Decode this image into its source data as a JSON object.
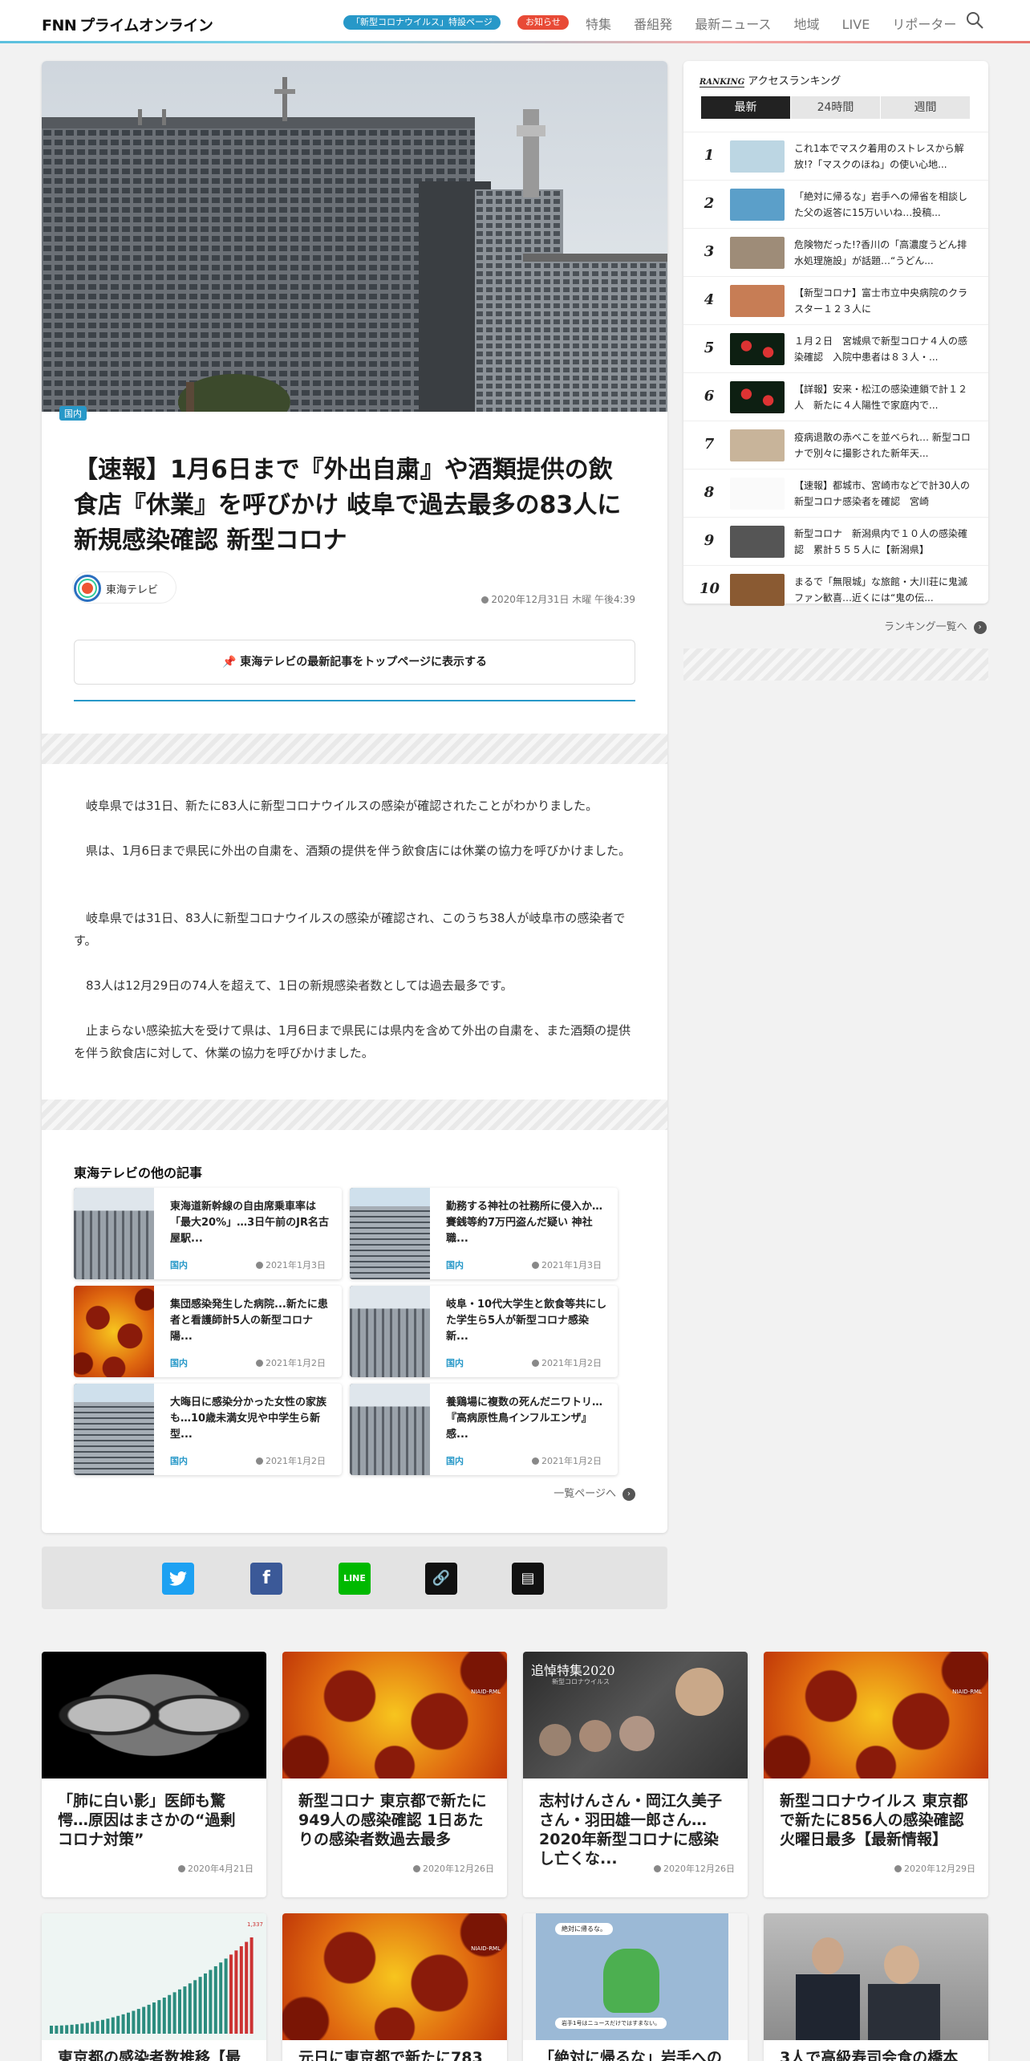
{
  "header": {
    "logo_fnn": "FNN",
    "logo_text": "プライムオンライン",
    "covid_pill": "「新型コロナウイルス」特設ページ",
    "notice_pill": "お知らせ",
    "nav": [
      "特集",
      "番組発",
      "最新ニュース",
      "地域",
      "LIVE",
      "リポーター"
    ]
  },
  "article": {
    "category": "国内",
    "title": "【速報】1月6日まで『外出自粛』や酒類提供の飲食店『休業』を呼びかけ 岐阜で過去最多の83人に新規感染確認 新型コロナ",
    "source": "東海テレビ",
    "date": "2020年12月31日 木曜 午後4:39",
    "follow_label": "東海テレビの最新記事をトップページに表示する",
    "paragraphs": [
      "岐阜県では31日、新たに83人に新型コロナウイルスの感染が確認されたことがわかりました。",
      "県は、1月6日まで県民に外出の自粛を、酒類の提供を伴う飲食店には休業の協力を呼びかけました。",
      "岐阜県では31日、83人に新型コロナウイルスの感染が確認され、このうち38人が岐阜市の感染者です。",
      "83人は12月29日の74人を超えて、1日の新規感染者数としては過去最多です。",
      "止まらない感染拡大を受けて県は、1月6日まで県民には県内を含めて外出の自粛を、また酒類の提供を伴う飲食店に対して、休業の協力を呼びかけました。"
    ]
  },
  "others": {
    "heading": "東海テレビの他の記事",
    "more": "一覧ページへ",
    "items": [
      {
        "title": "東海道新幹線の自由席乗車率は「最大20%」…3日午前のJR名古屋駅...",
        "category": "国内",
        "date": "2021年1月3日"
      },
      {
        "title": "勤務する神社の社務所に侵入か…賽銭等約7万円盗んだ疑い 神社職...",
        "category": "国内",
        "date": "2021年1月3日"
      },
      {
        "title": "集団感染発生した病院...新たに患者と看護師計5人の新型コロナ陽...",
        "category": "国内",
        "date": "2021年1月2日"
      },
      {
        "title": "岐阜・10代大学生と飲食等共にした学生ら5人が新型コロナ感染 新...",
        "category": "国内",
        "date": "2021年1月2日"
      },
      {
        "title": "大晦日に感染分かった女性の家族も…10歳未満女児や中学生ら新型...",
        "category": "国内",
        "date": "2021年1月2日"
      },
      {
        "title": "養鶏場に複数の死んだニワトリ…『高病原性鳥インフルエンザ』感...",
        "category": "国内",
        "date": "2021年1月2日"
      }
    ]
  },
  "ranking": {
    "badge": "RANKING",
    "heading": "アクセスランキング",
    "tabs": [
      "最新",
      "24時間",
      "週間"
    ],
    "more": "ランキング一覧へ",
    "items": [
      {
        "num": "1",
        "text": "これ1本でマスク着用のストレスから解放!?「マスクのほね」の使い心地..."
      },
      {
        "num": "2",
        "text": "「絶対に帰るな」岩手への帰省を相談した父の返答に15万いいね…投稿..."
      },
      {
        "num": "3",
        "text": "危険物だった!?香川の「高濃度うどん排水処理施設」が話題…“うどん..."
      },
      {
        "num": "4",
        "text": "【新型コロナ】富士市立中央病院のクラスター１２３人に"
      },
      {
        "num": "5",
        "text": "１月２日　宮城県で新型コロナ４人の感染確認　入院中患者は８３人・..."
      },
      {
        "num": "6",
        "text": "【詳報】安来・松江の感染連鎖で計１２人　新たに４人陽性で家庭内で..."
      },
      {
        "num": "7",
        "text": "疫病退散の赤べこを並べられ… 新型コロナで別々に撮影された新年天..."
      },
      {
        "num": "8",
        "text": "【速報】都城市、宮崎市などで計30人の新型コロナ感染者を確認　宮崎"
      },
      {
        "num": "9",
        "text": "新型コロナ　新潟県内で１０人の感染確認　累計５５５人に【新潟県】"
      },
      {
        "num": "10",
        "text": "まるで「無限城」な旅館・大川荘に鬼滅ファン歓喜…近くには“鬼の伝..."
      }
    ]
  },
  "bottom_grid": [
    {
      "title": "「肺に白い影」医師も驚愕…原因はまさかの“過剰コロナ対策”",
      "date": "2020年4月21日"
    },
    {
      "title": "新型コロナ 東京都で新たに949人の感染確認 1日あたりの感染者数過去最多",
      "date": "2020年12月26日"
    },
    {
      "title": "志村けんさん・岡江久美子さん・羽田雄一郎さん…2020年新型コロナに感染し亡くな...",
      "date": "2020年12月26日"
    },
    {
      "title": "新型コロナウイルス 東京都で新たに856人の感染確認　火曜日最多【最新情報】",
      "date": "2020年12月29日"
    }
  ],
  "bottom_grid2": [
    {
      "title": "東京都の感染者数推移【最"
    },
    {
      "title": "元日に東京都で新たに783"
    },
    {
      "title": "「絶対に帰るな」岩手への"
    },
    {
      "title": "3人で高級寿司会食の橋本"
    }
  ],
  "memorial_img_text": "追悼特集2020",
  "memorial_img_sub": "新型コロナウイルス",
  "photo_credit": "NIAID-RML",
  "chat_bubble_1": "絶対に帰るな。",
  "chat_bubble_2": "岩手1号はニュースだけではすまない。",
  "chart_top": "1,337",
  "colors": {
    "accent": "#2798c8",
    "notice": "#e84a36",
    "twitter": "#1da1f2",
    "facebook": "#3b5998",
    "line": "#00b900"
  }
}
